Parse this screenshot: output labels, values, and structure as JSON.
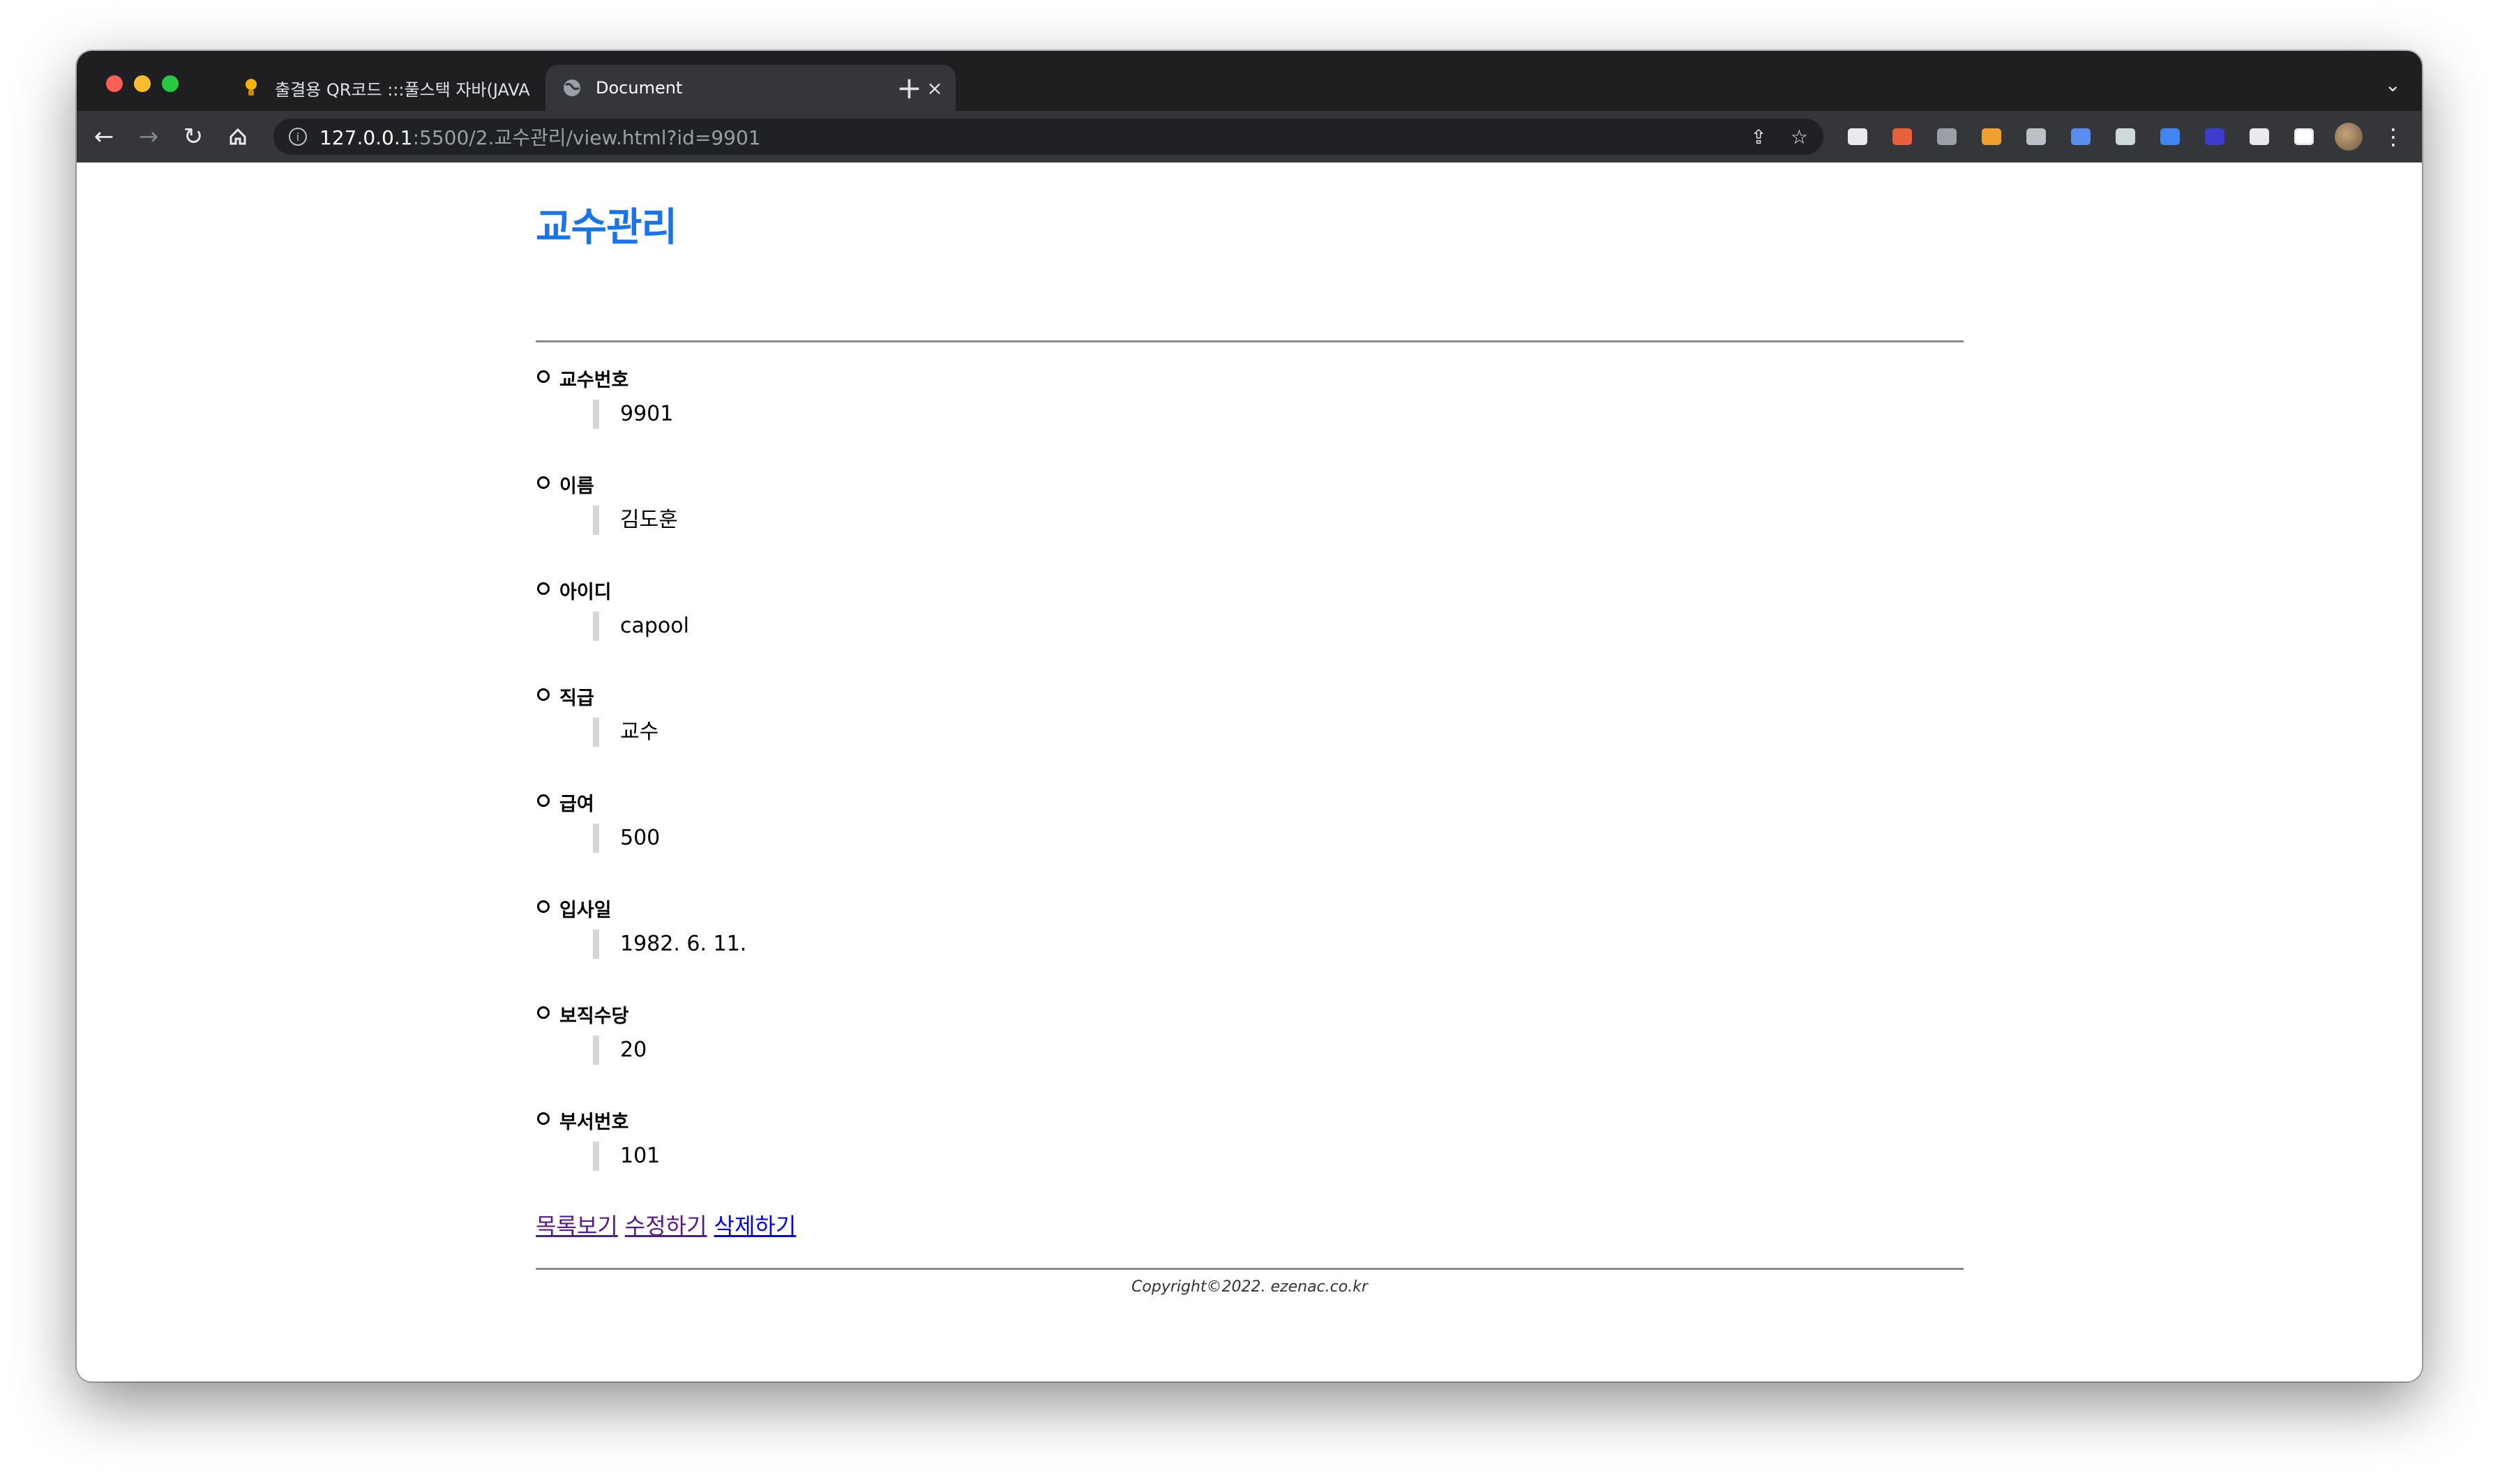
{
  "browser": {
    "tabs": [
      {
        "title": "출결용 QR코드 :::풀스택 자바(JAVA",
        "active": false,
        "favicon": "bulb-icon"
      },
      {
        "title": "Document",
        "active": true,
        "favicon": "globe-icon"
      }
    ],
    "url": {
      "host": "127.0.0.1",
      "rest": ":5500/2.교수관리/view.html?id=9901"
    }
  },
  "page": {
    "title": "교수관리",
    "fields": [
      {
        "label": "교수번호",
        "value": "9901"
      },
      {
        "label": "이름",
        "value": "김도훈"
      },
      {
        "label": "아이디",
        "value": "capool"
      },
      {
        "label": "직급",
        "value": "교수"
      },
      {
        "label": "급여",
        "value": "500"
      },
      {
        "label": "입사일",
        "value": "1982. 6. 11."
      },
      {
        "label": "보직수당",
        "value": "20"
      },
      {
        "label": "부서번호",
        "value": "101"
      }
    ],
    "links": {
      "list": "목록보기",
      "edit": "수정하기",
      "delete": "삭제하기"
    },
    "footer": "Copyright©2022. ezenac.co.kr"
  },
  "colors": {
    "title": "#1a73e8",
    "link": "#0000ee",
    "visited": "#551a8b"
  }
}
